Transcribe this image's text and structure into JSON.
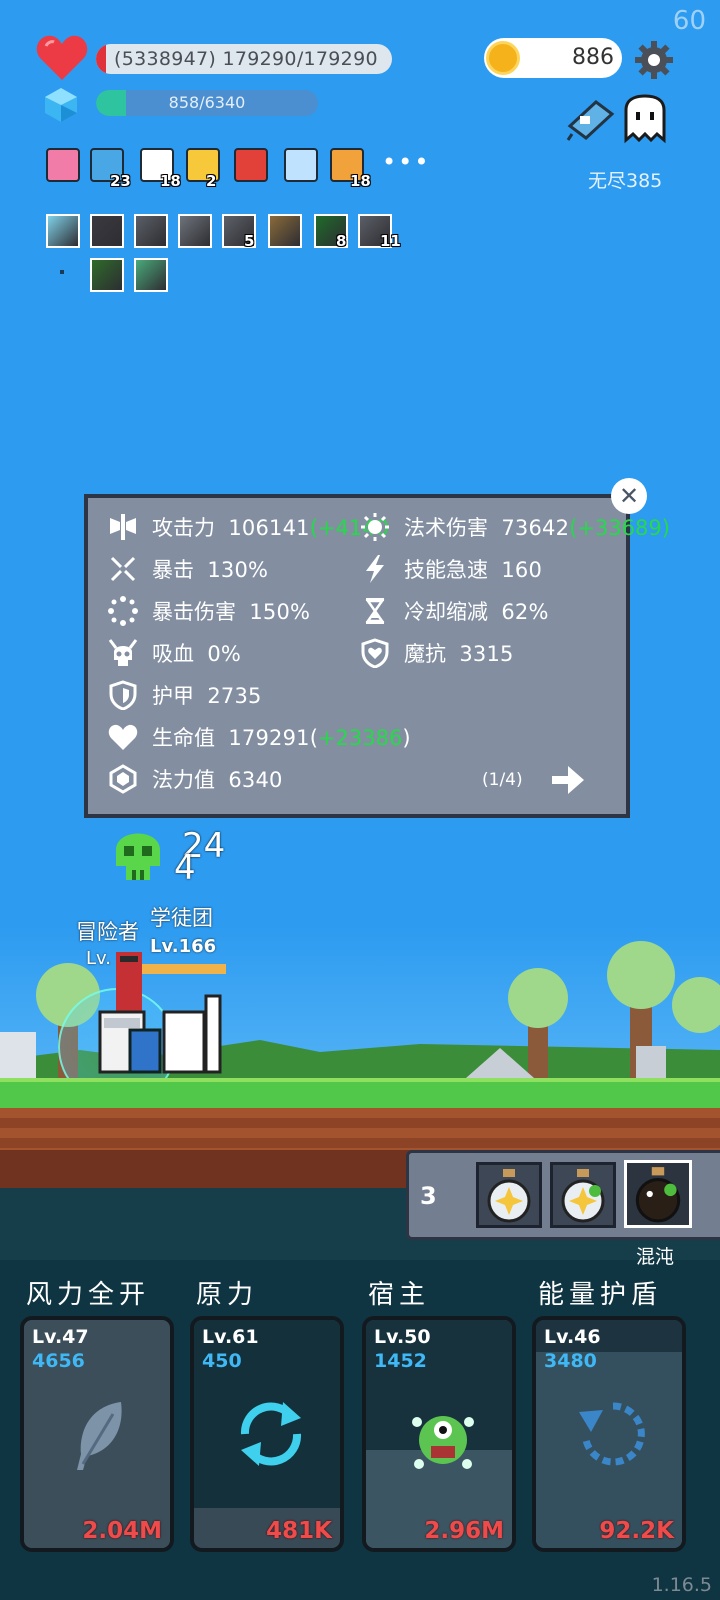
{
  "hud": {
    "fps": "60",
    "hp_text": "(5338947) 179290/179290",
    "mp_text": "858/6340",
    "mp_fraction": 0.135,
    "coins": "886",
    "endless_label": "无尽385"
  },
  "buffs": [
    {
      "icon": "jam-jar-icon",
      "count": ""
    },
    {
      "icon": "star-card-icon",
      "count": "23"
    },
    {
      "icon": "red-sock-icon",
      "count": "18"
    },
    {
      "icon": "crown-icon",
      "count": "2"
    },
    {
      "icon": "magnet-icon",
      "count": ""
    },
    {
      "icon": "magnifier-icon",
      "count": ""
    },
    {
      "icon": "book-icon",
      "count": "18"
    }
  ],
  "equipment": [
    {
      "icon": "light-orb-icon",
      "count": ""
    },
    {
      "icon": "dark-blade-icon",
      "count": ""
    },
    {
      "icon": "sword-icon",
      "count": ""
    },
    {
      "icon": "sword-icon",
      "count": ""
    },
    {
      "icon": "sword-icon",
      "count": "5"
    },
    {
      "icon": "armor-icon",
      "count": ""
    },
    {
      "icon": "green-rune-icon",
      "count": "8"
    },
    {
      "icon": "sword-icon",
      "count": "11"
    },
    {
      "icon": "herb-icon",
      "count": ""
    },
    {
      "icon": "spirit-icon",
      "count": ""
    }
  ],
  "stats": {
    "attack": {
      "label": "攻击力",
      "value": "106141",
      "bonus": "(+4140"
    },
    "magic_damage": {
      "label": "法术伤害",
      "value": "73642",
      "bonus": "(+33689)"
    },
    "crit": {
      "label": "暴击",
      "value": "130%"
    },
    "skill_haste": {
      "label": "技能急速",
      "value": "160"
    },
    "crit_damage": {
      "label": "暴击伤害",
      "value": "150%"
    },
    "cooldown": {
      "label": "冷却缩减",
      "value": "62%"
    },
    "lifesteal": {
      "label": "吸血",
      "value": "0%"
    },
    "magic_resist": {
      "label": "魔抗",
      "value": "3315"
    },
    "armor": {
      "label": "护甲",
      "value": "2735"
    },
    "health": {
      "label": "生命值",
      "value": "179291",
      "bonus": "+23386",
      "open": "(",
      "close": ")"
    },
    "mana": {
      "label": "法力值",
      "value": "6340"
    },
    "page": "(1/4)"
  },
  "scene": {
    "damage_numbers": [
      "24",
      "4"
    ],
    "hero_name": "冒险者",
    "hero_level": "Lv.",
    "ally_label": "学徒团",
    "ally_level": "Lv.166"
  },
  "potions": {
    "count": "3",
    "selected_label": "混沌"
  },
  "skills": [
    {
      "name": "风力全开",
      "level": "Lv.47",
      "cost": "4656",
      "value": "2.04M",
      "icon": "feather-icon"
    },
    {
      "name": "原力",
      "level": "Lv.61",
      "cost": "450",
      "value": "481K",
      "icon": "refresh-icon"
    },
    {
      "name": "宿主",
      "level": "Lv.50",
      "cost": "1452",
      "value": "2.96M",
      "icon": "monster-icon"
    },
    {
      "name": "能量护盾",
      "level": "Lv.46",
      "cost": "3480",
      "value": "92.2K",
      "icon": "cooldown-arrow-icon"
    }
  ],
  "version": "1.16.5",
  "colors": {
    "sky": "#2d9bf0",
    "panel": "#838fa1",
    "bonus_green": "#27d94a",
    "damage_red": "#f04b4b",
    "cost_blue": "#3fb8f5"
  }
}
